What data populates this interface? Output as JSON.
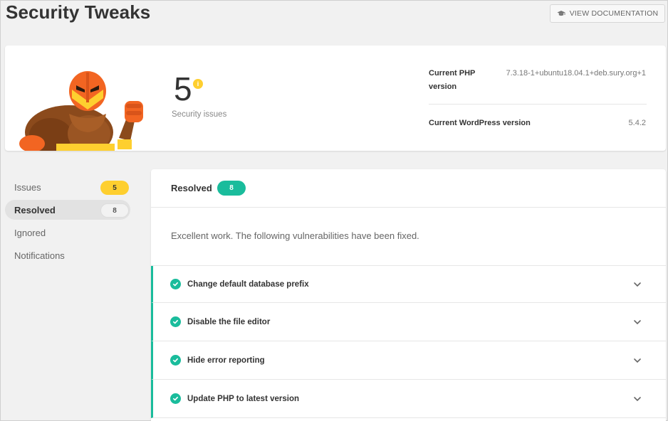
{
  "header": {
    "title": "Security Tweaks",
    "doc_button_label": "VIEW DOCUMENTATION",
    "doc_button_icon": "academic-cap-icon"
  },
  "summary": {
    "issue_count": "5",
    "issue_indicator": "i",
    "issue_label": "Security issues",
    "php_label": "Current PHP version",
    "php_value": "7.3.18-1+ubuntu18.04.1+deb.sury.org+1",
    "wp_label": "Current WordPress version",
    "wp_value": "5.4.2"
  },
  "sidebar": {
    "items": [
      {
        "label": "Issues",
        "badge": "5",
        "badge_type": "warning",
        "active": false
      },
      {
        "label": "Resolved",
        "badge": "8",
        "badge_type": "neutral",
        "active": true
      },
      {
        "label": "Ignored",
        "badge": "",
        "active": false
      },
      {
        "label": "Notifications",
        "badge": "",
        "active": false
      }
    ]
  },
  "panel": {
    "title": "Resolved",
    "badge": "8",
    "description": "Excellent work. The following vulnerabilities have been fixed.",
    "tweaks": [
      {
        "label": "Change default database prefix",
        "status_icon": "check-circle-icon",
        "expand_icon": "chevron-down-icon"
      },
      {
        "label": "Disable the file editor",
        "status_icon": "check-circle-icon",
        "expand_icon": "chevron-down-icon"
      },
      {
        "label": "Hide error reporting",
        "status_icon": "check-circle-icon",
        "expand_icon": "chevron-down-icon"
      },
      {
        "label": "Update PHP to latest version",
        "status_icon": "check-circle-icon",
        "expand_icon": "chevron-down-icon"
      }
    ]
  },
  "colors": {
    "accent_green": "#1abc9c",
    "warning_yellow": "#fecf2f",
    "page_bg": "#f1f1f1",
    "mascot_orange": "#f26522",
    "mascot_brown": "#8b4a1c"
  }
}
